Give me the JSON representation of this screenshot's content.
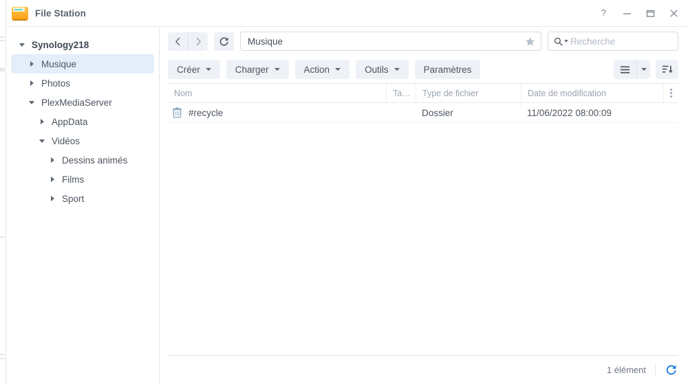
{
  "window": {
    "title": "File Station",
    "icon": "folder-icon",
    "controls": [
      {
        "name": "help-button",
        "glyph": "?"
      },
      {
        "name": "minimize-button",
        "glyph": "—"
      },
      {
        "name": "maximize-button",
        "glyph": "▭"
      },
      {
        "name": "close-button",
        "glyph": "✕"
      }
    ]
  },
  "sidebar": {
    "items": [
      {
        "label": "Synology218",
        "indent": 0,
        "twisty": "down",
        "selected": false,
        "root": true
      },
      {
        "label": "Musique",
        "indent": 1,
        "twisty": "right",
        "selected": true,
        "root": false
      },
      {
        "label": "Photos",
        "indent": 1,
        "twisty": "right",
        "selected": false,
        "root": false
      },
      {
        "label": "PlexMediaServer",
        "indent": 1,
        "twisty": "down",
        "selected": false,
        "root": false
      },
      {
        "label": "AppData",
        "indent": 2,
        "twisty": "right",
        "selected": false,
        "root": false
      },
      {
        "label": "Vidéos",
        "indent": 2,
        "twisty": "down",
        "selected": false,
        "root": false
      },
      {
        "label": "Dessins animés",
        "indent": 3,
        "twisty": "right",
        "selected": false,
        "root": false
      },
      {
        "label": "Films",
        "indent": 3,
        "twisty": "right",
        "selected": false,
        "root": false
      },
      {
        "label": "Sport",
        "indent": 3,
        "twisty": "right",
        "selected": false,
        "root": false
      }
    ]
  },
  "navbar": {
    "back_icon": "chevron-left-icon",
    "forward_icon": "chevron-right-icon",
    "refresh_icon": "refresh-icon",
    "path_value": "Musique",
    "path_placeholder": "",
    "favorite_icon": "star-icon",
    "search_icon": "search-icon",
    "search_value": "",
    "search_placeholder": "Recherche"
  },
  "toolbar": {
    "buttons": [
      {
        "label": "Créer",
        "dropdown": true
      },
      {
        "label": "Charger",
        "dropdown": true
      },
      {
        "label": "Action",
        "dropdown": true
      },
      {
        "label": "Outils",
        "dropdown": true
      },
      {
        "label": "Paramètres",
        "dropdown": false
      }
    ],
    "view_icon": "list-view-icon",
    "view_dropdown_icon": "chevron-down-icon",
    "sort_icon": "sort-descending-icon"
  },
  "table": {
    "columns": [
      {
        "label": "Nom"
      },
      {
        "label": "Ta…"
      },
      {
        "label": "Type de fichier"
      },
      {
        "label": "Date de modification"
      }
    ],
    "column_menu_icon": "kebab-menu-icon",
    "rows": [
      {
        "icon": "trash-icon",
        "name": "#recycle",
        "size": "",
        "type": "Dossier",
        "modified": "11/06/2022 08:00:09"
      }
    ]
  },
  "statusbar": {
    "count_text": "1 élément",
    "refresh_icon": "refresh-icon",
    "refresh_color": "#1c7ce0"
  },
  "colors": {
    "accent": "#1c7ce0",
    "selection": "#e4eefa",
    "folder": "#ff9f15",
    "button_bg": "#eef1f6",
    "text": "#4c555f",
    "muted": "#9aa3af"
  }
}
